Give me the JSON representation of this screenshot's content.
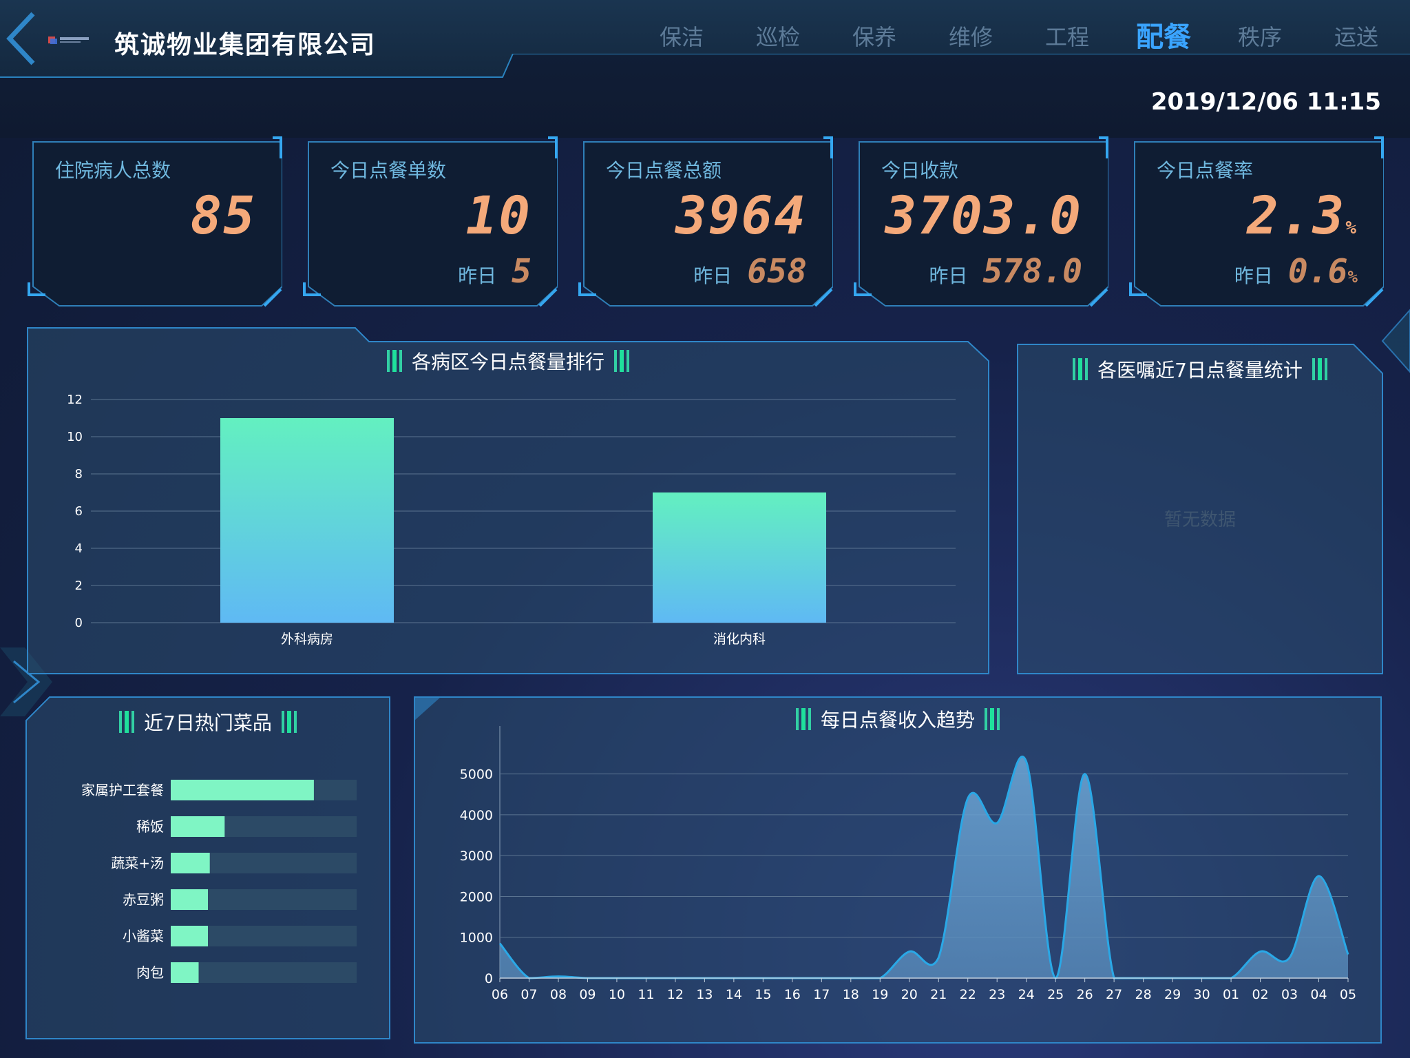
{
  "header": {
    "company": "筑诚物业集团有限公司",
    "datetime": "2019/12/06 11:15",
    "tabs": [
      {
        "label": "保洁",
        "active": false
      },
      {
        "label": "巡检",
        "active": false
      },
      {
        "label": "保养",
        "active": false
      },
      {
        "label": "维修",
        "active": false
      },
      {
        "label": "工程",
        "active": false
      },
      {
        "label": "配餐",
        "active": true
      },
      {
        "label": "秩序",
        "active": false
      },
      {
        "label": "运送",
        "active": false
      }
    ]
  },
  "cards": [
    {
      "label": "住院病人总数",
      "value": "85",
      "unit": "",
      "yesterday_label": "",
      "yesterday": "",
      "yesterday_unit": ""
    },
    {
      "label": "今日点餐单数",
      "value": "10",
      "unit": "",
      "yesterday_label": "昨日",
      "yesterday": "5",
      "yesterday_unit": ""
    },
    {
      "label": "今日点餐总额",
      "value": "3964",
      "unit": "",
      "yesterday_label": "昨日",
      "yesterday": "658",
      "yesterday_unit": ""
    },
    {
      "label": "今日收款",
      "value": "3703.0",
      "unit": "",
      "yesterday_label": "昨日",
      "yesterday": "578.0",
      "yesterday_unit": ""
    },
    {
      "label": "今日点餐率",
      "value": "2.3",
      "unit": "%",
      "yesterday_label": "昨日",
      "yesterday": "0.6",
      "yesterday_unit": "%"
    }
  ],
  "panels": {
    "ward_ranking": {
      "title": "各病区今日点餐量排行"
    },
    "doctor_order": {
      "title": "各医嘱近7日点餐量统计",
      "empty_text": "暂无数据"
    },
    "hot_dishes": {
      "title": "近7日热门菜品"
    },
    "revenue_trend": {
      "title": "每日点餐收入趋势"
    }
  },
  "colors": {
    "accent": "#3aa4ff",
    "digit": "#f4a97a",
    "bar_top": "#63f0c0",
    "bar_bottom": "#5fb9f4",
    "dish_bar": "#7ff5c4",
    "area_line": "#2aa8e6"
  },
  "chart_data": [
    {
      "type": "bar",
      "title": "各病区今日点餐量排行",
      "categories": [
        "外科病房",
        "消化内科"
      ],
      "values": [
        11,
        7
      ],
      "ylim": [
        0,
        12
      ],
      "yticks": [
        0,
        2,
        4,
        6,
        8,
        10,
        12
      ],
      "grid": true
    },
    {
      "type": "bar",
      "orientation": "horizontal",
      "title": "近7日热门菜品",
      "categories": [
        "家属护工套餐",
        "稀饭",
        "蔬菜+汤",
        "赤豆粥",
        "小酱菜",
        "肉包"
      ],
      "values": [
        77,
        29,
        21,
        20,
        20,
        15
      ],
      "xlim": [
        0,
        100
      ]
    },
    {
      "type": "area",
      "title": "每日点餐收入趋势",
      "categories": [
        "06",
        "07",
        "08",
        "09",
        "10",
        "11",
        "12",
        "13",
        "14",
        "15",
        "16",
        "17",
        "18",
        "19",
        "20",
        "21",
        "22",
        "23",
        "24",
        "25",
        "26",
        "27",
        "28",
        "29",
        "30",
        "01",
        "02",
        "03",
        "04",
        "05"
      ],
      "values": [
        850,
        0,
        40,
        0,
        0,
        0,
        0,
        0,
        0,
        0,
        0,
        0,
        0,
        0,
        650,
        500,
        4400,
        3800,
        5300,
        0,
        5000,
        0,
        0,
        0,
        0,
        0,
        650,
        500,
        2500,
        580
      ],
      "ylim": [
        0,
        5500
      ],
      "yticks": [
        0,
        1000,
        2000,
        3000,
        4000,
        5000
      ],
      "grid": true
    }
  ]
}
